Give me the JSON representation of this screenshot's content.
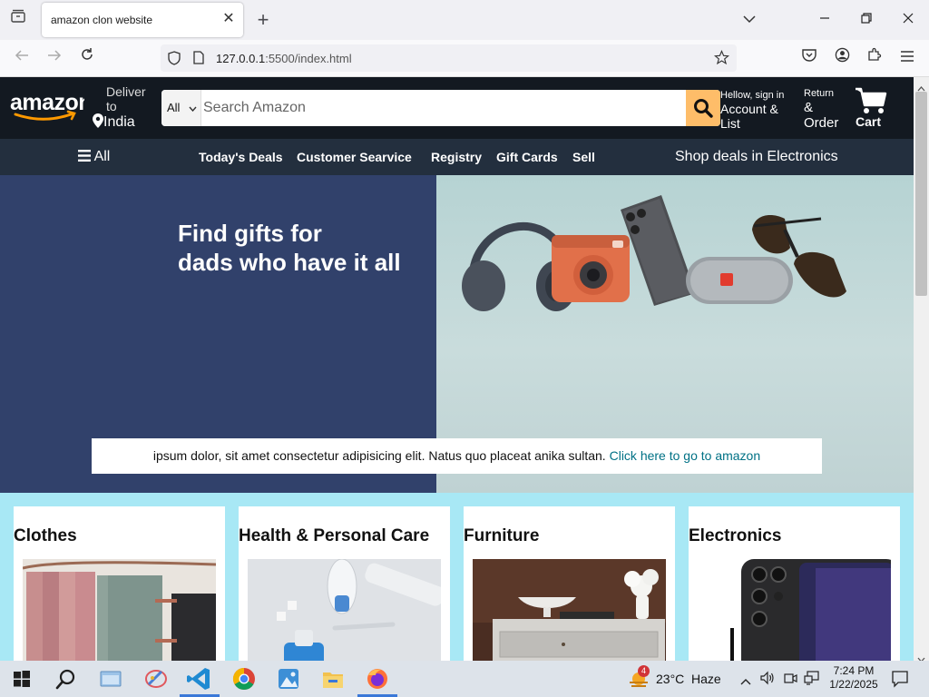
{
  "browser": {
    "tab_title": "amazon clon website",
    "url_host": "127.0.0.1",
    "url_rest": ":5500/index.html"
  },
  "header": {
    "deliver_line1": "Deliver",
    "deliver_line2": "to",
    "deliver_country": "India",
    "search_category": "All",
    "search_placeholder": "Search Amazon",
    "account_line1": "Hellow, sign in",
    "account_line2": "Account &",
    "account_line3": "List",
    "returns_line1": "Return",
    "returns_line2": "&",
    "returns_line3": "Order",
    "cart_label": "Cart"
  },
  "nav": {
    "all_label": "All",
    "items": [
      "Today's Deals",
      "Customer Searvice",
      "Registry",
      "Gift Cards",
      "Sell"
    ],
    "promo": "Shop deals in Electronics"
  },
  "hero": {
    "title_line1": "Find gifts for",
    "title_line2": "dads who have it all",
    "banner_text": "ipsum dolor, sit amet consectetur adipisicing elit. Natus quo placeat anika sultan. ",
    "banner_link": "Click here to go to amazon"
  },
  "cards": [
    {
      "title": "Clothes"
    },
    {
      "title": "Health & Personal Care"
    },
    {
      "title": "Furniture"
    },
    {
      "title": "Electronics"
    }
  ],
  "taskbar": {
    "weather_temp": "23°C",
    "weather_desc": "Haze",
    "weather_badge": "4",
    "time": "7:24 PM",
    "date": "1/22/2025"
  },
  "colors": {
    "amazon_dark": "#131921",
    "amazon_nav": "#232f3e",
    "search_button": "#febd69",
    "hero_bg": "#31416b",
    "cards_bg": "#a8e8f5",
    "link": "#007185"
  }
}
